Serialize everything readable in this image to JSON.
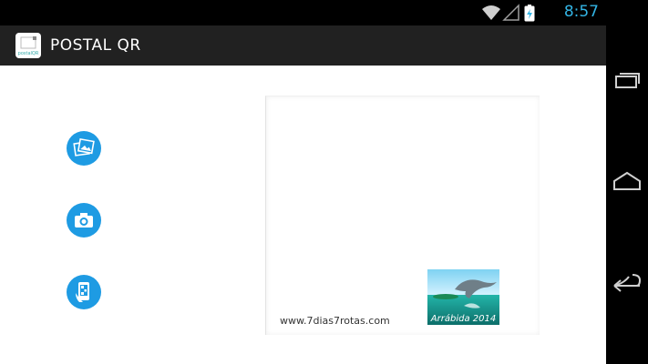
{
  "status_bar": {
    "time": "8:57",
    "icons": [
      "wifi-icon",
      "signal-icon",
      "battery-icon"
    ]
  },
  "action_bar": {
    "title": "POSTAL QR",
    "app_icon_text": "postalQR"
  },
  "actions": [
    {
      "name": "gallery",
      "icon": "image-gallery-icon"
    },
    {
      "name": "camera",
      "icon": "camera-icon"
    },
    {
      "name": "qr-scan",
      "icon": "qr-phone-icon"
    }
  ],
  "postcard": {
    "url": "www.7dias7rotas.com",
    "stamp_label": "Arrábida 2014"
  },
  "nav": [
    "recent-apps-icon",
    "home-icon",
    "back-icon"
  ],
  "colors": {
    "accent": "#1e9be3",
    "status": "#33b5e5",
    "actionbar": "#212121"
  }
}
